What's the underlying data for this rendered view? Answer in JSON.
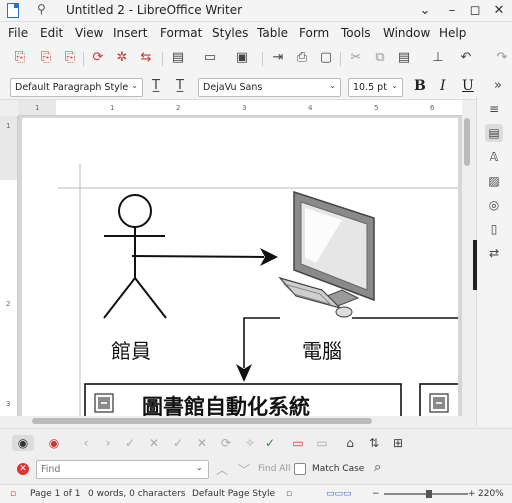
{
  "window": {
    "title": "Untitled 2 - LibreOffice Writer"
  },
  "menu": [
    "File",
    "Edit",
    "View",
    "Insert",
    "Format",
    "Styles",
    "Table",
    "Form",
    "Tools",
    "Window",
    "Help"
  ],
  "formatting": {
    "paragraph_style": "Default Paragraph Style",
    "font_name": "DejaVu Sans",
    "font_size": "10.5 pt",
    "bold": "B",
    "italic": "I",
    "underline": "U"
  },
  "ruler": {
    "h_ticks": [
      "1",
      "1",
      "2",
      "3",
      "4",
      "5",
      "6"
    ],
    "v_ticks": [
      "1",
      "2",
      "3"
    ]
  },
  "diagram": {
    "actor_label": "館員",
    "computer_label": "電腦",
    "box_title": "圖書館自動化系統"
  },
  "findbar": {
    "placeholder": "Find",
    "find_all": "Find All",
    "match_case": "Match Case"
  },
  "status": {
    "page": "Page 1 of 1",
    "words": "0 words, 0 characters",
    "page_style": "Default Page Style",
    "zoom": "220%"
  }
}
